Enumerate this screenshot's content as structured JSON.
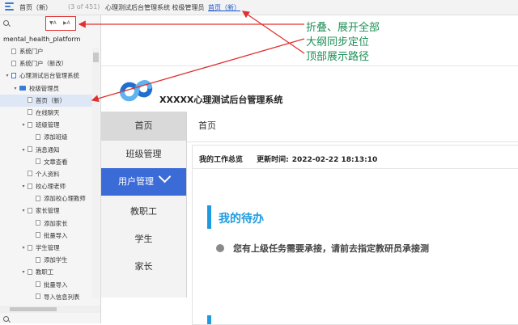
{
  "topbar": {
    "menu_icon": "list-icon",
    "crumb_home": "首页（新）",
    "crumb_count": "(3 of 451)",
    "crumb_path": "心理测试后台管理系统  校级管理员  首页（新）",
    "crumb_path_start": "心理测试后台管理系统  校级管理员",
    "crumb_current": "首页（新）"
  },
  "outline": {
    "search_icon": "search-icon",
    "collapse_label": "▼A",
    "expand_label": "▶A",
    "root_title": "mental_health_platform",
    "items": [
      {
        "label": "系统门户",
        "indent": 0,
        "twisty": "",
        "icon": "page"
      },
      {
        "label": "系统门户（新改）",
        "indent": 0,
        "twisty": "",
        "icon": "page"
      },
      {
        "label": "心理测试后台管理系统",
        "indent": 0,
        "twisty": "▾",
        "icon": "page-blue"
      },
      {
        "label": "校级管理员",
        "indent": 1,
        "twisty": "▾",
        "icon": "folder"
      },
      {
        "label": "首页（新）",
        "indent": 2,
        "twisty": "",
        "icon": "page",
        "selected": true
      },
      {
        "label": "在线聊天",
        "indent": 2,
        "twisty": "",
        "icon": "page"
      },
      {
        "label": "班级管理",
        "indent": 2,
        "twisty": "▾",
        "icon": "page"
      },
      {
        "label": "添加班级",
        "indent": 3,
        "twisty": "",
        "icon": "page"
      },
      {
        "label": "消息通知",
        "indent": 2,
        "twisty": "▾",
        "icon": "page"
      },
      {
        "label": "文章查看",
        "indent": 3,
        "twisty": "",
        "icon": "page"
      },
      {
        "label": "个人资料",
        "indent": 2,
        "twisty": "",
        "icon": "page"
      },
      {
        "label": "校心理老师",
        "indent": 2,
        "twisty": "▾",
        "icon": "page"
      },
      {
        "label": "添加校心理教师",
        "indent": 3,
        "twisty": "",
        "icon": "page"
      },
      {
        "label": "家长管理",
        "indent": 2,
        "twisty": "▾",
        "icon": "page"
      },
      {
        "label": "添加家长",
        "indent": 3,
        "twisty": "",
        "icon": "page"
      },
      {
        "label": "批量导入",
        "indent": 3,
        "twisty": "",
        "icon": "page"
      },
      {
        "label": "学生管理",
        "indent": 2,
        "twisty": "▾",
        "icon": "page"
      },
      {
        "label": "添加学生",
        "indent": 3,
        "twisty": "",
        "icon": "page"
      },
      {
        "label": "教职工",
        "indent": 2,
        "twisty": "▾",
        "icon": "page"
      },
      {
        "label": "批量导入",
        "indent": 3,
        "twisty": "",
        "icon": "page"
      },
      {
        "label": "导入信息列表",
        "indent": 3,
        "twisty": "",
        "icon": "page"
      }
    ]
  },
  "page": {
    "system_title": "XXXXX心理测试后台管理系统",
    "nav": {
      "home": "首页",
      "class_mgmt": "班级管理",
      "user_mgmt": "用户管理",
      "staff": "教职工",
      "student": "学生",
      "parent": "家长"
    },
    "main_tab": "首页",
    "overview": "我的工作总览",
    "update_label": "更新时间:",
    "update_time": "2022-02-22 18:13:10",
    "todo_title": "我的待办",
    "todo_text": "您有上级任务需要承接，请前去指定教研员承接测"
  },
  "annotations": {
    "collapse_all": "折叠、展开全部",
    "outline_sync": "大纲同步定位",
    "top_path": "顶部展示路径"
  },
  "colors": {
    "accent": "#3b6bd6",
    "todo_blue": "#1e9be0",
    "annotation_green": "#1d8f55",
    "arrow_red": "#e03030"
  }
}
